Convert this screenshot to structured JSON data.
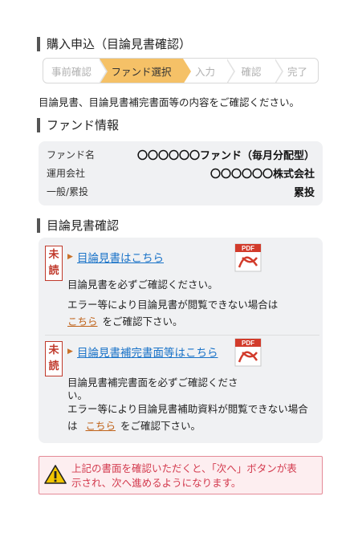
{
  "header": {
    "title": "購入申込（目論見書確認）"
  },
  "stepper": {
    "steps": [
      "事前確認",
      "ファンド選択",
      "入力",
      "確認",
      "完了"
    ],
    "active_index": 1
  },
  "intro": "目論見書、目論見書補完書面等の内容をご確認ください。",
  "fund_info": {
    "heading": "ファンド情報",
    "rows": [
      {
        "label": "ファンド名",
        "value": "〇〇〇〇〇〇ファンド（毎月分配型）"
      },
      {
        "label": "運用会社",
        "value": "〇〇〇〇〇〇株式会社"
      },
      {
        "label": "一般/累投",
        "value": "累投"
      }
    ]
  },
  "docs": {
    "heading": "目論見書確認",
    "unread_label_1": "未",
    "unread_label_2": "読",
    "pdf_icon_label": "PDF",
    "items": [
      {
        "link": "目論見書はこちら",
        "note": "目論見書を必ずご確認ください。",
        "error_text": "エラー等により目論見書が閲覧できない場合は",
        "alt_link": "こちら",
        "alt_suffix": "をご確認下さい。"
      },
      {
        "link": "目論見書補完書面等はこちら",
        "note_line1": "目論見書補完書面を必ずご確認くださ",
        "note_line2": "い。",
        "error_line1": "エラー等により目論見書補助資料が閲覧できない場合",
        "error_prefix": "は",
        "alt_link": "こちら",
        "alt_suffix": "をご確認下さい。"
      }
    ]
  },
  "warning": {
    "line1": "上記の書面を確認いただくと、「次へ」ボタンが表",
    "line2": "示され、次へ進めるようになります。"
  }
}
